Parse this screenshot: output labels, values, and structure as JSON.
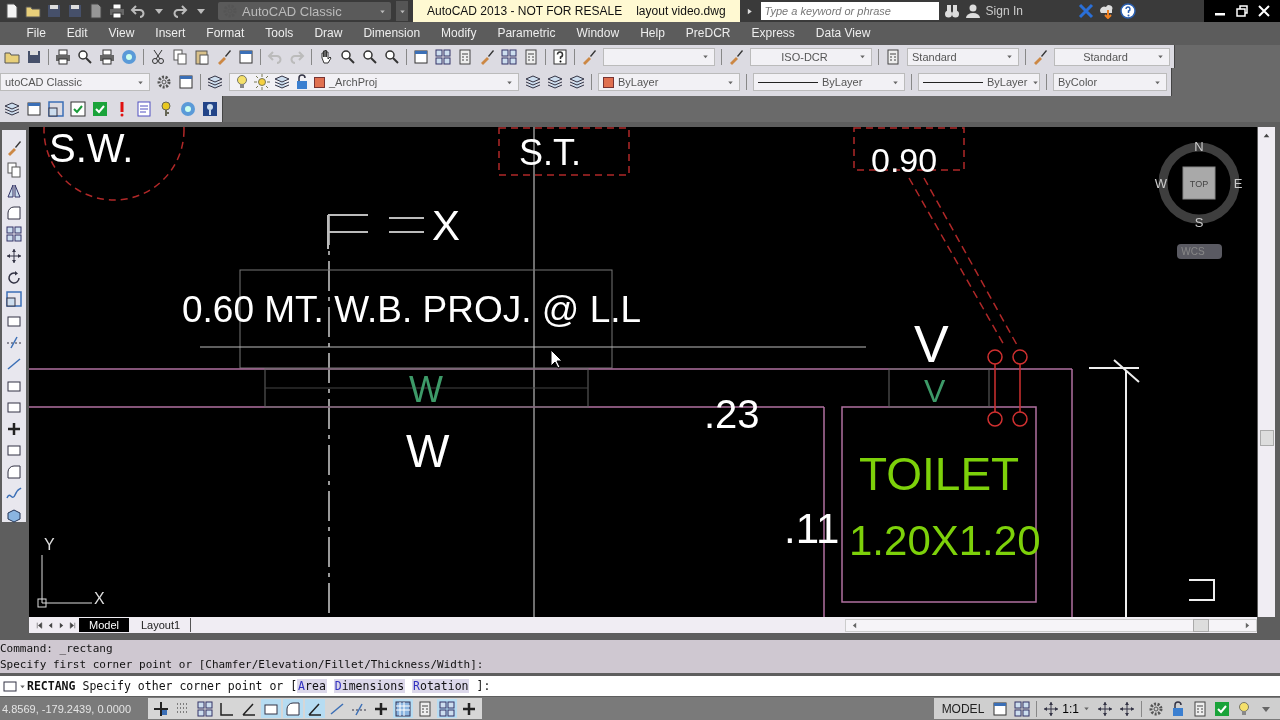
{
  "title_bar": {
    "workspace": "AutoCAD Classic",
    "app_title": "AutoCAD 2013 - NOT FOR RESALE",
    "file_name": "layout video.dwg",
    "search": {
      "placeholder": "Type a keyword or phrase"
    },
    "sign_in": "Sign In"
  },
  "menu_bar": [
    "File",
    "Edit",
    "View",
    "Insert",
    "Format",
    "Tools",
    "Draw",
    "Dimension",
    "Modify",
    "Parametric",
    "Window",
    "Help",
    "PreDCR",
    "Express",
    "Data View"
  ],
  "styles_toolbar": {
    "dimension_style": "ISO-DCR",
    "table_style": "Standard",
    "multileader_style": "Standard"
  },
  "properties_toolbar": {
    "workspace": "utoCAD Classic",
    "layer": "_ArchProj",
    "object_color": "ByLayer",
    "linetype": "ByLayer",
    "lineweight": "ByLayer",
    "plot_style": "ByColor"
  },
  "drawing": {
    "texts": [
      {
        "text": "S.W.",
        "kind": "note"
      },
      {
        "text": "S.T.",
        "kind": "note"
      },
      {
        "text": "0.90",
        "kind": "note"
      },
      {
        "text": "X",
        "kind": "note"
      },
      {
        "text": "0.60 MT. W.B. PROJ. @ L.L",
        "kind": "note"
      },
      {
        "text": "V",
        "kind": "note"
      },
      {
        "text": "W",
        "kind": "tag"
      },
      {
        "text": "V",
        "kind": "tag"
      },
      {
        "text": ".23",
        "kind": "note"
      },
      {
        "text": "W",
        "kind": "note"
      },
      {
        "text": "TOILET",
        "kind": "room"
      },
      {
        "text": ".11",
        "kind": "note"
      },
      {
        "text": "1.20X1.20",
        "kind": "room"
      }
    ],
    "ucs": {
      "y": "Y",
      "x": "X"
    },
    "viewcube": {
      "north": "N",
      "west": "W",
      "face": "TOP",
      "east": "E",
      "south": "S",
      "coordinate_system": "WCS"
    }
  },
  "layout_tabs": [
    {
      "label": "Model",
      "selected": true
    },
    {
      "label": "Layout1",
      "selected": false
    }
  ],
  "command_history": [
    "Command: _rectang",
    "Specify first corner point or [Chamfer/Elevation/Fillet/Thickness/Width]:"
  ],
  "command_line": {
    "command": "RECTANG",
    "prompt": "Specify other corner point or [",
    "options": [
      {
        "hotkey": "A",
        "rest": "rea"
      },
      {
        "hotkey": "D",
        "rest": "imensions"
      },
      {
        "hotkey": "R",
        "rest": "otation"
      }
    ],
    "end": "]:"
  },
  "status_bar": {
    "coordinates": "4.8569, -179.2439, 0.0000",
    "toggles": [
      {
        "on": false
      },
      {
        "on": false
      },
      {
        "on": false
      },
      {
        "on": false
      },
      {
        "on": false
      },
      {
        "on": true
      },
      {
        "on": true
      },
      {
        "on": true
      },
      {
        "on": false
      },
      {
        "on": false
      },
      {
        "on": false
      },
      {
        "on": true
      },
      {
        "on": false
      },
      {
        "on": true
      },
      {
        "on": false
      }
    ],
    "space": "MODEL",
    "annotation_scale": "1:1"
  }
}
